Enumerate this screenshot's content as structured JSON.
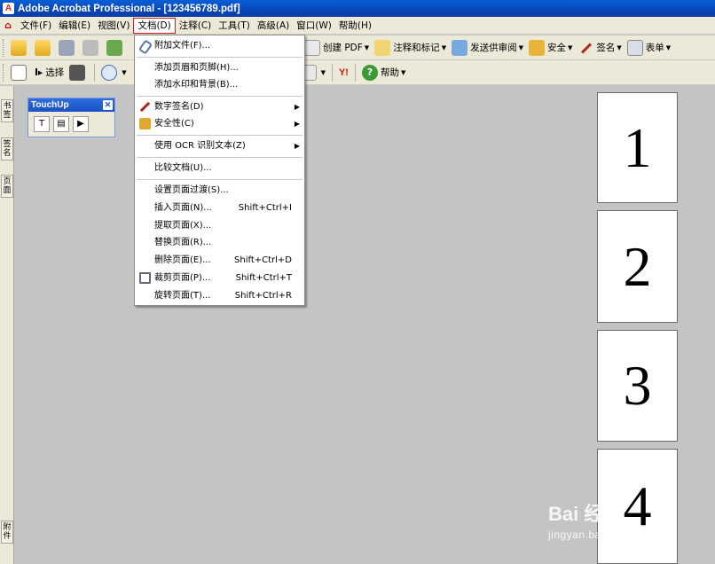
{
  "window": {
    "title": "Adobe Acrobat Professional - [123456789.pdf]"
  },
  "menubar": {
    "items": [
      "文件(F)",
      "编辑(E)",
      "视图(V)",
      "文档(D)",
      "注释(C)",
      "工具(T)",
      "高级(A)",
      "窗口(W)",
      "帮助(H)"
    ],
    "active_index": 3
  },
  "toolbar1": {
    "create_pdf": "创建 PDF",
    "comment_markup": "注释和标记",
    "send_review": "发送供审阅",
    "security": "安全",
    "sign": "签名",
    "forms": "表单"
  },
  "toolbar2": {
    "select": "选择",
    "yahoo": "Y!",
    "help": "帮助"
  },
  "leftnav": {
    "tabs": [
      "书签",
      "签名",
      "页面",
      "附件"
    ]
  },
  "touchup": {
    "title": "TouchUp"
  },
  "pages": [
    "1",
    "2",
    "3",
    "4"
  ],
  "document_menu": [
    {
      "label": "附加文件(F)...",
      "icon": "paperclip-icon"
    },
    {
      "label": "添加页眉和页脚(H)..."
    },
    {
      "label": "添加水印和背景(B)..."
    },
    {
      "label": "数字签名(D)",
      "icon": "pen-icon",
      "submenu": true
    },
    {
      "label": "安全性(C)",
      "icon": "lock-icon",
      "submenu": true
    },
    {
      "label": "使用 OCR 识别文本(Z)",
      "submenu": true
    },
    {
      "label": "比较文档(U)..."
    },
    {
      "label": "设置页面过渡(S)..."
    },
    {
      "label": "插入页面(N)...",
      "shortcut": "Shift+Ctrl+I"
    },
    {
      "label": "提取页面(X)..."
    },
    {
      "label": "替换页面(R)..."
    },
    {
      "label": "删除页面(E)...",
      "shortcut": "Shift+Ctrl+D"
    },
    {
      "label": "裁剪页面(P)...",
      "icon": "crop-icon",
      "shortcut": "Shift+Ctrl+T"
    },
    {
      "label": "旋转页面(T)...",
      "shortcut": "Shift+Ctrl+R"
    }
  ],
  "watermark": {
    "line1": "Bai 经验",
    "line2": "jingyan.baidu.com"
  }
}
